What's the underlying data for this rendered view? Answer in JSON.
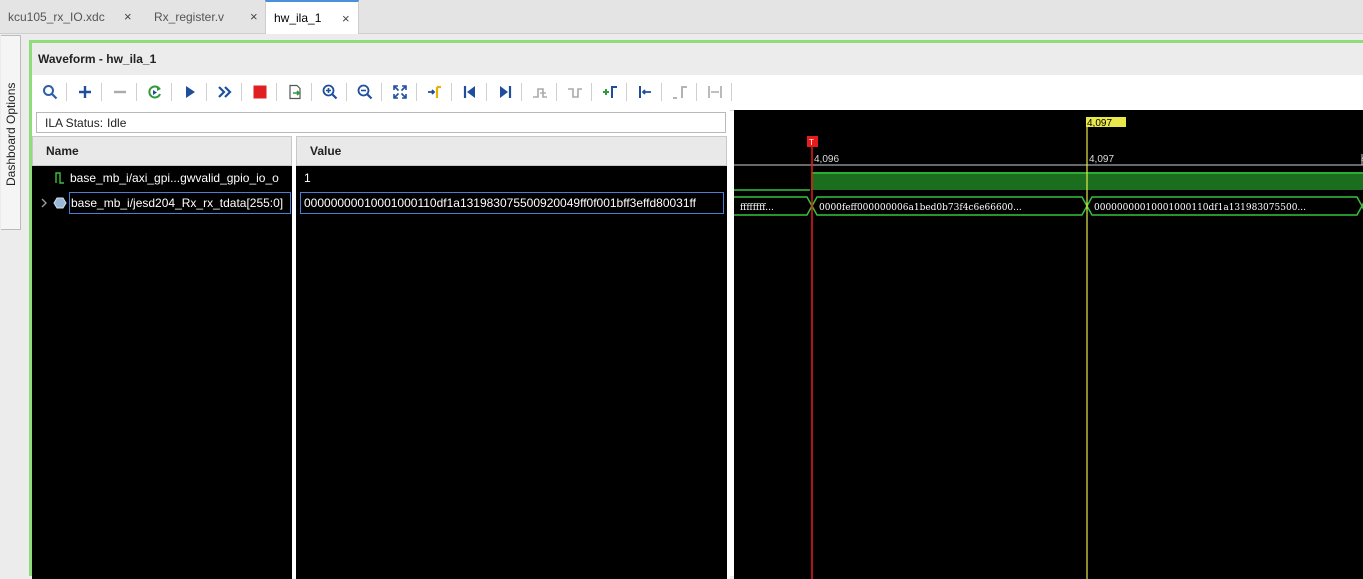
{
  "tabs": [
    {
      "label": "kcu105_rx_IO.xdc",
      "close": "×"
    },
    {
      "label": "Rx_register.v",
      "close": "×"
    },
    {
      "label": "hw_ila_1",
      "close": "×"
    }
  ],
  "sidebar": {
    "label": "Dashboard Options"
  },
  "window": {
    "title": "Waveform - hw_ila_1"
  },
  "toolbar": {
    "icons": [
      "search-icon",
      "add-icon",
      "remove-icon",
      "refresh-icon",
      "run-trigger-icon",
      "run-immediate-icon",
      "stop-icon",
      "export-icon",
      "zoom-in-icon",
      "zoom-out-icon",
      "zoom-fit-icon",
      "go-to-cursor-icon",
      "go-to-start-icon",
      "go-to-end-icon",
      "previous-transition-icon",
      "next-transition-icon",
      "add-marker-icon",
      "previous-marker-icon",
      "next-marker-icon",
      "swap-cursors-icon"
    ]
  },
  "status": {
    "label": "ILA Status:",
    "value": "Idle"
  },
  "columns": {
    "name": "Name",
    "value": "Value"
  },
  "signals": [
    {
      "name": "base_mb_i/axi_gpi...gwvalid_gpio_io_o",
      "value": "1",
      "icon": "bit-signal-icon"
    },
    {
      "name": "base_mb_i/jesd204_Rx_rx_tdata[255:0]",
      "value": "00000000010001000110df1a131983075500920049ff0f001bff3effd80031ff",
      "icon": "bus-signal-icon"
    }
  ],
  "timeline": {
    "cursor_top": "4,097",
    "trigger_marker": "T",
    "ticks": [
      "4,096",
      "4,097",
      "4"
    ],
    "bus_segments": [
      "ffffffff...",
      "0000feff000000006a1bed0b73f4c6e66600...",
      "00000000010001000110df1a131983075500..."
    ]
  },
  "colors": {
    "accent_border": "#8fdc7a",
    "wave_green": "#36c23a",
    "cursor_yellow": "#e8e84a",
    "trigger_red": "#e81a1a"
  }
}
